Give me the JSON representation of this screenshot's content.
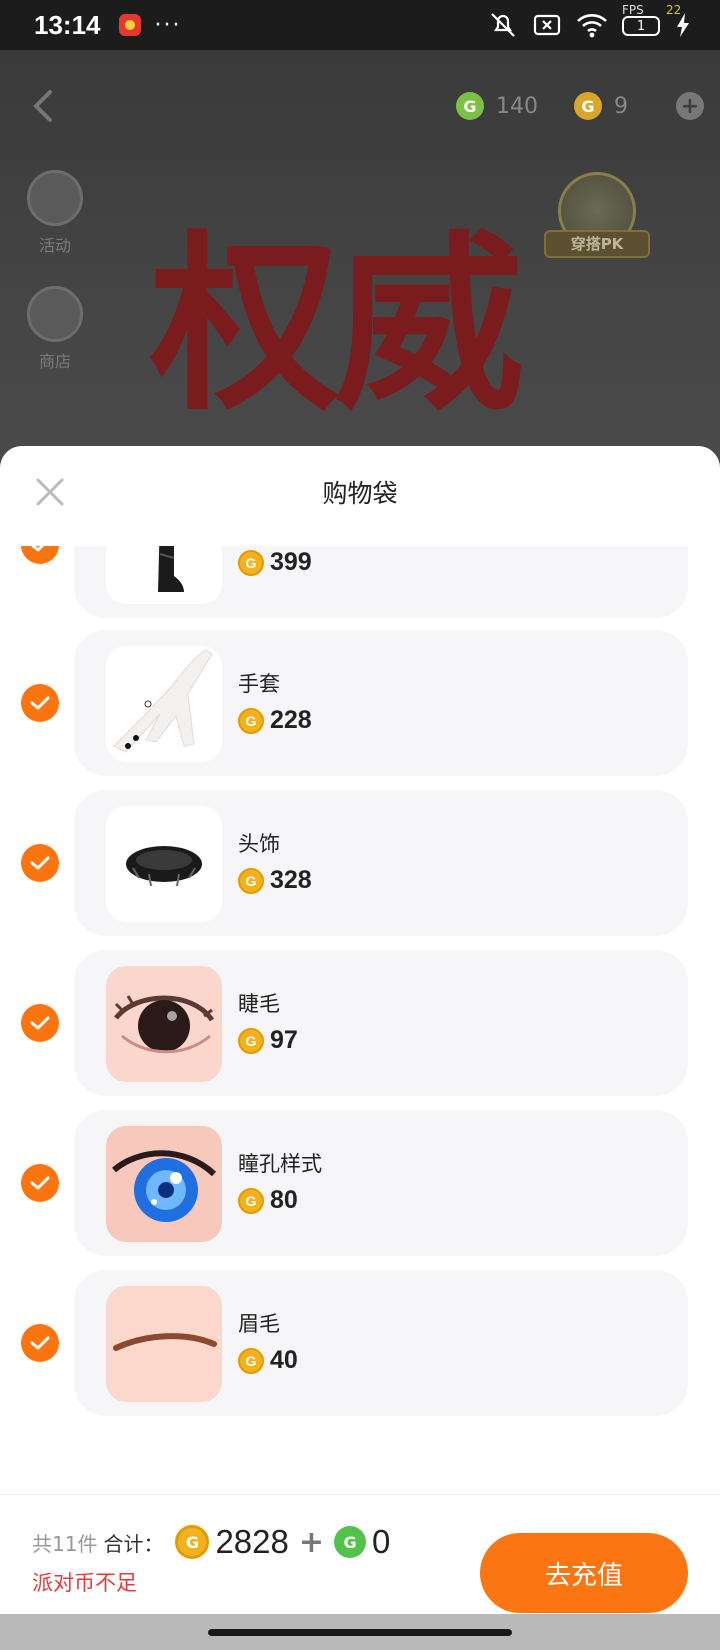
{
  "status": {
    "time": "13:14",
    "more": "···",
    "battery": "1",
    "fps_label": "FPS",
    "fps_value": "22"
  },
  "game": {
    "coin_green_amount": "140",
    "coin_gold_amount": "9",
    "side_items": [
      {
        "label": "活动",
        "icon": "balloon-icon"
      },
      {
        "label": "商店",
        "icon": "gift-icon"
      }
    ],
    "pk_badge_label": "穿搭PK",
    "title_text": "权威"
  },
  "sheet": {
    "title": "购物袋",
    "items": [
      {
        "name": "",
        "price": "399",
        "thumb": "boots"
      },
      {
        "name": "手套",
        "price": "228",
        "thumb": "glove"
      },
      {
        "name": "头饰",
        "price": "328",
        "thumb": "headpiece"
      },
      {
        "name": "睫毛",
        "price": "97",
        "thumb": "eyelash"
      },
      {
        "name": "瞳孔样式",
        "price": "80",
        "thumb": "pupil"
      },
      {
        "name": "眉毛",
        "price": "40",
        "thumb": "eyebrow"
      }
    ]
  },
  "footer": {
    "count_text": "共11件",
    "total_label": "合计：",
    "total_gold": "2828",
    "plus": "+",
    "total_green": "0",
    "warning": "派对币不足",
    "recharge_label": "去充值"
  },
  "colors": {
    "accent": "#fb7512",
    "warning": "#e53b3b",
    "check": "#fa7410"
  }
}
